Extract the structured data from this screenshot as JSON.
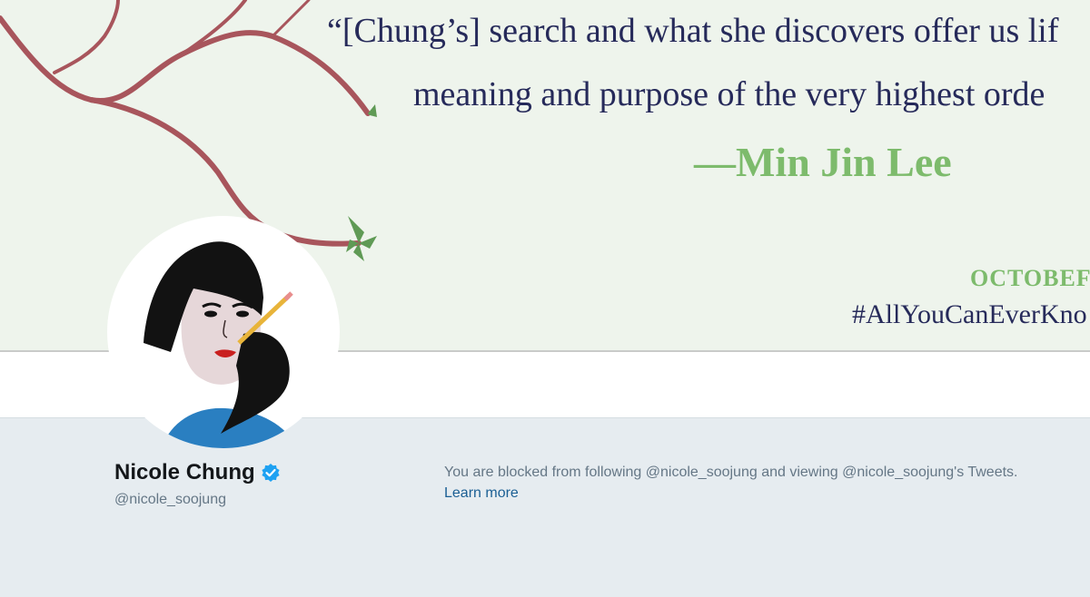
{
  "banner": {
    "quote_line1": "“[Chung’s] search and what she discovers offer us lif",
    "quote_line2": "meaning and purpose of the very highest orde",
    "author": "—Min Jin Lee",
    "date_text": "OCTOBEF",
    "hashtag": "#AllYouCanEverKno"
  },
  "profile": {
    "name": "Nicole Chung",
    "handle": "@nicole_soojung",
    "verified_icon": "verified-badge-icon"
  },
  "notice": {
    "blocked_text": "You are blocked from following @nicole_soojung and viewing @nicole_soojung's Tweets.",
    "learn_more": "Learn more"
  },
  "colors": {
    "banner_bg": "#eef4ec",
    "quote": "#262a5a",
    "author_green": "#7dbb6c",
    "page_bg": "#e6ecf0",
    "link": "#1b5f94",
    "verified_blue": "#1da1f2"
  }
}
